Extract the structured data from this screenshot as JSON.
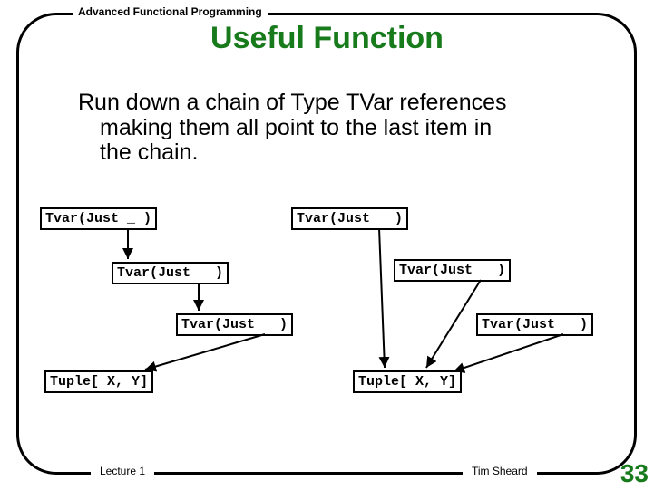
{
  "header": "Advanced Functional Programming",
  "title": "Useful Function",
  "body": {
    "line1": "Run down a chain of Type TVar references",
    "line2": "making them all point  to the last item in",
    "line3": "the chain."
  },
  "nodes": {
    "left1": "Tvar(Just _ )",
    "left2": "Tvar(Just   )",
    "left3": "Tvar(Just   )",
    "leftTuple": "Tuple[ X, Y]",
    "right1": "Tvar(Just   )",
    "right2": "Tvar(Just   )",
    "right3": "Tvar(Just   )",
    "rightTuple": "Tuple[ X, Y]"
  },
  "footer": {
    "lecture": "Lecture 1",
    "author": "Tim Sheard"
  },
  "page": "33"
}
